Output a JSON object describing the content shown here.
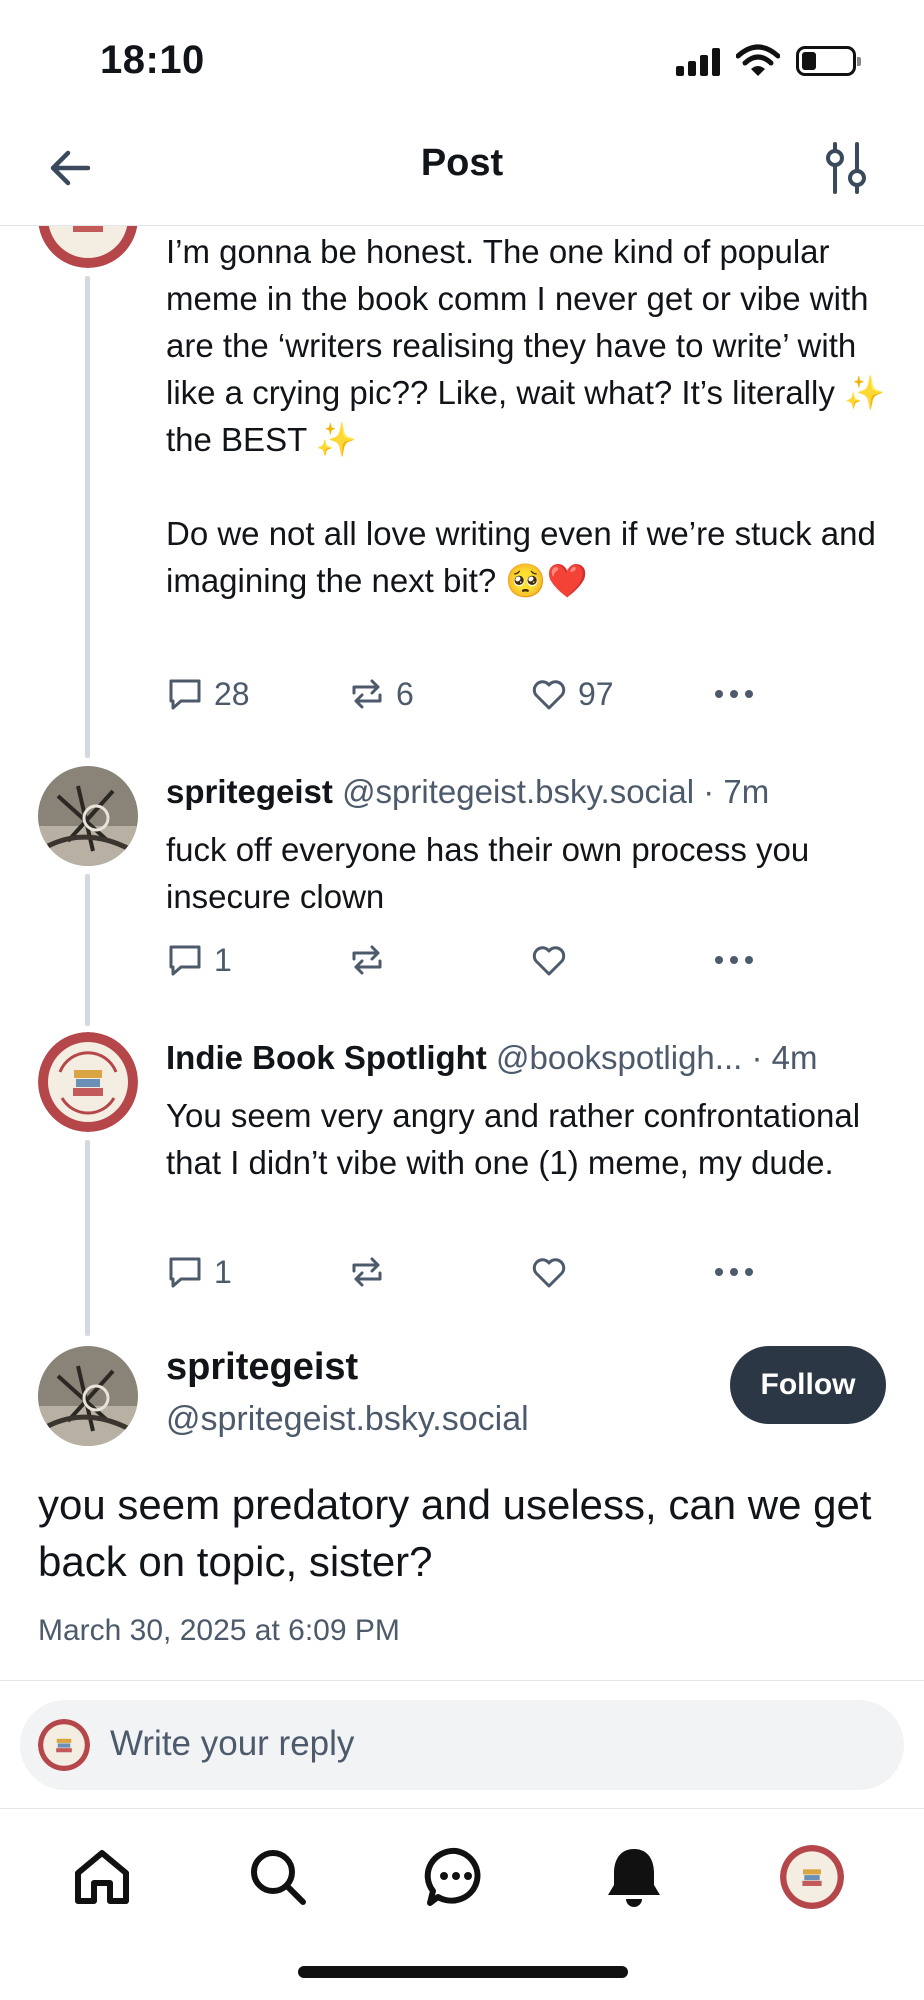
{
  "status_bar": {
    "time": "18:10"
  },
  "header": {
    "title": "Post",
    "back_icon": "arrow-left-icon",
    "filter_icon": "sliders-icon"
  },
  "parent_post": {
    "author_avatar": "indie-book-spotlight-logo",
    "text": "I’m gonna be honest. The one kind of popular meme in the book comm I never get or vibe with are the ‘writers realising they have to write’ with like a crying pic?? Like, wait what? It’s literally ✨ the BEST ✨\n\nDo we not all love writing even if we’re stuck and imagining the next bit? 🥺❤️",
    "replies": "28",
    "reposts": "6",
    "likes": "97"
  },
  "replies": [
    {
      "name": "spritegeist",
      "handle": "@spritegeist.bsky.social",
      "time": "· 7m",
      "text": "fuck off everyone has their own process you insecure clown",
      "replies": "1",
      "reposts": "",
      "likes": ""
    },
    {
      "name": "Indie Book Spotlight",
      "handle": "@bookspotligh...",
      "time": "· 4m",
      "text": "You seem very angry and rather confrontational that I didn’t vibe with one (1) meme, my dude.",
      "replies": "1",
      "reposts": "",
      "likes": ""
    }
  ],
  "focused_post": {
    "name": "spritegeist",
    "handle": "@spritegeist.bsky.social",
    "follow_label": "Follow",
    "text": "you seem predatory and useless, can we get back on topic, sister?",
    "date": "March 30, 2025 at 6:09 PM"
  },
  "composer": {
    "placeholder": "Write your reply"
  },
  "tabbar": {
    "items": [
      "home-icon",
      "search-icon",
      "chat-icon",
      "bell-icon",
      "profile-avatar"
    ]
  },
  "colors": {
    "text": "#111418",
    "muted": "#4c5a6b",
    "follow_bg": "#2c3745",
    "thread_line": "#d4d9df",
    "badge_red": "#b5474b"
  }
}
